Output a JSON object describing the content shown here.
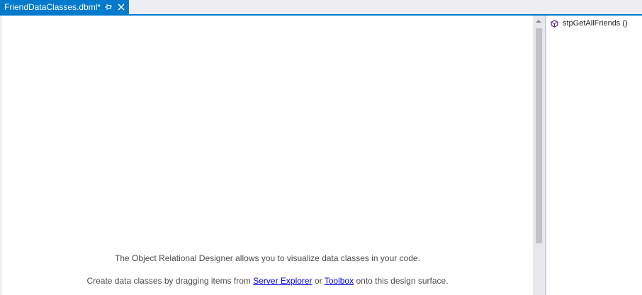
{
  "tab": {
    "title": "FriendDataClasses.dbml*",
    "pin_icon": "pin-icon",
    "close_icon": "close-icon"
  },
  "design_surface": {
    "hint_line1": "The Object Relational Designer allows you to visualize data classes in your code.",
    "hint_line2_prefix": "Create data classes by dragging items from ",
    "link_server_explorer": "Server Explorer",
    "hint_line2_middle": " or ",
    "link_toolbox": "Toolbox",
    "hint_line2_suffix": " onto this design surface."
  },
  "methods_pane": {
    "items": [
      {
        "label": "stpGetAllFriends ()",
        "icon": "method-cube-icon"
      }
    ]
  },
  "colors": {
    "accent": "#007acc",
    "link": "#0000ee",
    "method_icon": "#652d90"
  }
}
